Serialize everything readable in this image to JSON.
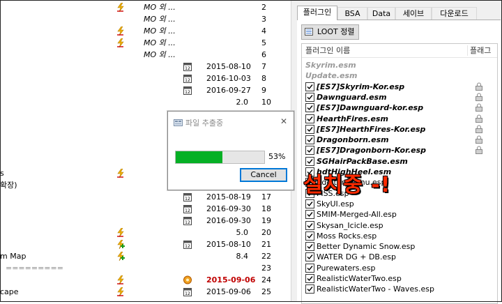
{
  "mods": [
    {
      "name": "",
      "lightning": true,
      "mo": "MO 외 ...",
      "date": "",
      "ver": "",
      "pri": "2"
    },
    {
      "name": "",
      "lightning": false,
      "mo": "MO 외 ...",
      "date": "",
      "ver": "",
      "pri": "3"
    },
    {
      "name": "",
      "lightning": true,
      "mo": "MO 외 ...",
      "date": "",
      "ver": "",
      "pri": "4"
    },
    {
      "name": "",
      "lightning": true,
      "mo": "MO 외 ...",
      "date": "",
      "ver": "",
      "pri": "5"
    },
    {
      "name": "",
      "lightning": false,
      "mo": "MO 외 ...",
      "date": "",
      "ver": "",
      "pri": "6"
    },
    {
      "name": "",
      "lightning": false,
      "mo": "",
      "cal": true,
      "date": "2015-08-10",
      "ver": "",
      "pri": "7"
    },
    {
      "name": "",
      "lightning": false,
      "mo": "",
      "cal": true,
      "date": "2016-10-03",
      "ver": "",
      "pri": "8"
    },
    {
      "name": "",
      "lightning": false,
      "mo": "",
      "cal": true,
      "date": "2016-09-27",
      "ver": "",
      "pri": "9"
    },
    {
      "name": "",
      "lightning": false,
      "mo": "",
      "date": "",
      "ver": "2.0",
      "pri": "10"
    },
    {
      "name": "",
      "lightning": false,
      "mo": "",
      "date": "",
      "ver": "",
      "pri": ""
    },
    {
      "name": "",
      "lightning": false,
      "mo": "",
      "date": "",
      "ver": "",
      "pri": ""
    },
    {
      "name": "",
      "lightning": false,
      "mo": "",
      "date": "",
      "ver": "",
      "pri": ""
    },
    {
      "name": "",
      "lightning": false,
      "mo": "",
      "date": "",
      "ver": "",
      "pri": ""
    },
    {
      "name": "",
      "lightning": false,
      "mo": "",
      "date": "",
      "ver": "",
      "pri": ""
    },
    {
      "name": "s",
      "lightning": true,
      "mo": "",
      "date": "",
      "ver": "",
      "pri": ""
    },
    {
      "name": "확장)",
      "lightning": false,
      "mo": "",
      "date": "",
      "ver": "",
      "pri": ""
    },
    {
      "name": "",
      "lightning": false,
      "mo": "",
      "cal": true,
      "date": "2015-08-19",
      "ver": "",
      "pri": "17"
    },
    {
      "name": "",
      "lightning": false,
      "mo": "",
      "cal": true,
      "date": "2016-09-30",
      "ver": "",
      "pri": "18"
    },
    {
      "name": "",
      "lightning": false,
      "mo": "",
      "cal": true,
      "date": "2016-09-30",
      "ver": "",
      "pri": "19"
    },
    {
      "name": "",
      "lightning": true,
      "mo": "",
      "date": "",
      "ver": "5.0",
      "pri": "20"
    },
    {
      "name": "",
      "lightning": true,
      "plus": true,
      "mo": "",
      "cal": true,
      "date": "2015-08-10",
      "ver": "",
      "pri": "21"
    },
    {
      "name": "m Map",
      "lightning": true,
      "plus": true,
      "mo": "",
      "date": "",
      "ver": "8.4",
      "pri": "22"
    },
    {
      "name": "=========",
      "lightning": false,
      "mo": "",
      "date": "",
      "ver": "",
      "pri": "23",
      "sepline": true
    },
    {
      "name": "",
      "lightning": true,
      "mo": "",
      "warn": true,
      "date": "2015-09-06",
      "red": true,
      "ver": "",
      "pri": "24"
    },
    {
      "name": "cape",
      "lightning": true,
      "mo": "",
      "cal": true,
      "date": "2015-09-06",
      "ver": "",
      "pri": "25"
    }
  ],
  "tabs": [
    "플러그인",
    "BSA",
    "Data",
    "세이브",
    "다운로드"
  ],
  "loot_label": "LOOT 정렬",
  "plugin_header": {
    "name": "플러그인 이름",
    "flags": "플래그"
  },
  "plugins": [
    {
      "name": "Skyrim.esm",
      "locked": true
    },
    {
      "name": "Update.esm",
      "locked": true
    },
    {
      "name": "[ES7]Skyrim-Kor.esp",
      "esm": true,
      "lock": true
    },
    {
      "name": "Dawnguard.esm",
      "esm": true,
      "lock": true
    },
    {
      "name": "[ES7]Dawnguard-kor.esp",
      "esm": true,
      "lock": true
    },
    {
      "name": "HearthFires.esm",
      "esm": true,
      "lock": true
    },
    {
      "name": "[ES7]HearthFires-Kor.esp",
      "esm": true,
      "lock": true
    },
    {
      "name": "Dragonborn.esm",
      "esm": true,
      "lock": true
    },
    {
      "name": "[ES7]Dragonborn-Kor.esp",
      "esm": true,
      "lock": true
    },
    {
      "name": "SGHairPackBase.esm",
      "esm": true
    },
    {
      "name": "hdtHighHeel.esm",
      "esm": true
    },
    {
      "name": "AddItemMenu.esp"
    },
    {
      "name": "FISS.esp"
    },
    {
      "name": "SkyUI.esp"
    },
    {
      "name": "SMIM-Merged-All.esp"
    },
    {
      "name": "Skysan_Icicle.esp"
    },
    {
      "name": "Moss Rocks.esp"
    },
    {
      "name": "Better Dynamic Snow.esp"
    },
    {
      "name": "WATER DG + DB.esp"
    },
    {
      "name": "Purewaters.esp"
    },
    {
      "name": "RealisticWaterTwo.esp"
    },
    {
      "name": "RealisticWaterTwo - Waves.esp"
    }
  ],
  "dialog": {
    "title": "파일 추출중",
    "close": "✕",
    "progress": 0.53,
    "percent": "53%",
    "cancel": "Cancel"
  },
  "overlay_text": "설치중 -!"
}
